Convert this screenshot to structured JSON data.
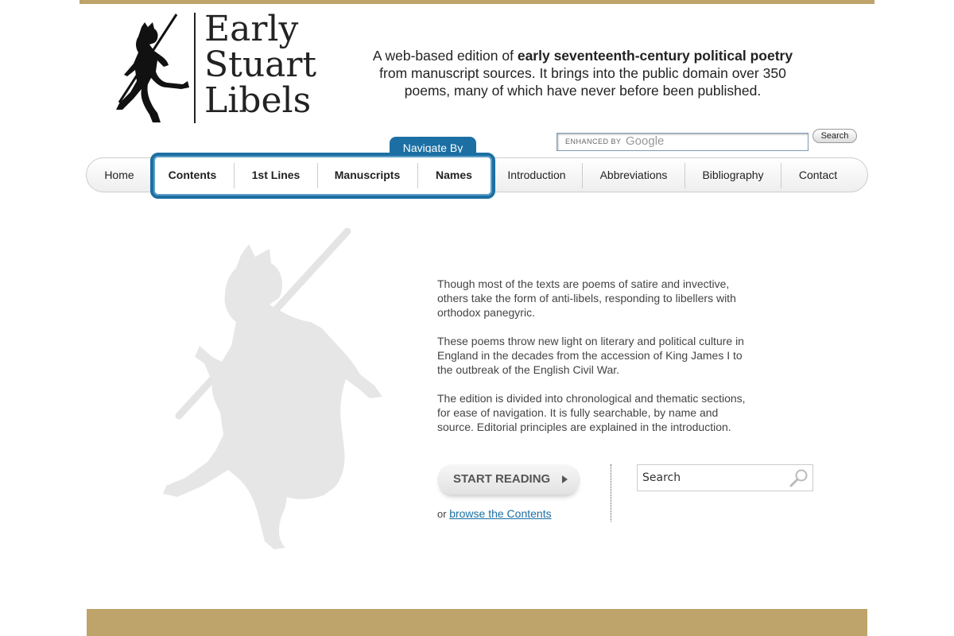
{
  "brand": {
    "line1": "Early",
    "line2": "Stuart",
    "line3": "Libels"
  },
  "tagline": {
    "pre": "A web-based edition of ",
    "bold": "early seventeenth-century political poetry",
    "post": " from manuscript sources. It brings into the public domain over 350 poems, many of which have never before been published."
  },
  "google_search": {
    "enhanced_label": "ENHANCED BY",
    "brand": "Google",
    "button": "Search"
  },
  "nav": {
    "tab_label": "Navigate By",
    "items": [
      "Home",
      "Contents",
      "1st Lines",
      "Manuscripts",
      "Names",
      "Introduction",
      "Abbreviations",
      "Bibliography",
      "Contact"
    ]
  },
  "content": {
    "paragraphs": [
      "Though most of the texts are poems of satire and invective, others take the form of anti-libels, responding to libellers with orthodox panegyric.",
      "These poems throw new light on literary and political culture in England in the decades from the accession of King James I to the outbreak of the English Civil War.",
      "The edition is divided into chronological and thematic sections, for ease of navigation. It is fully searchable, by name and source. Editorial principles are explained in the introduction."
    ]
  },
  "cta": {
    "start_reading": "START READING",
    "or": "or",
    "browse_link": "browse the Contents"
  },
  "search": {
    "placeholder": "Search"
  },
  "colors": {
    "gold": "#bea46a",
    "nav_blue": "#1b6fa3"
  },
  "icons": {
    "logo": "devil-logo",
    "search": "magnifier-icon",
    "arrow": "play-arrow-icon"
  }
}
